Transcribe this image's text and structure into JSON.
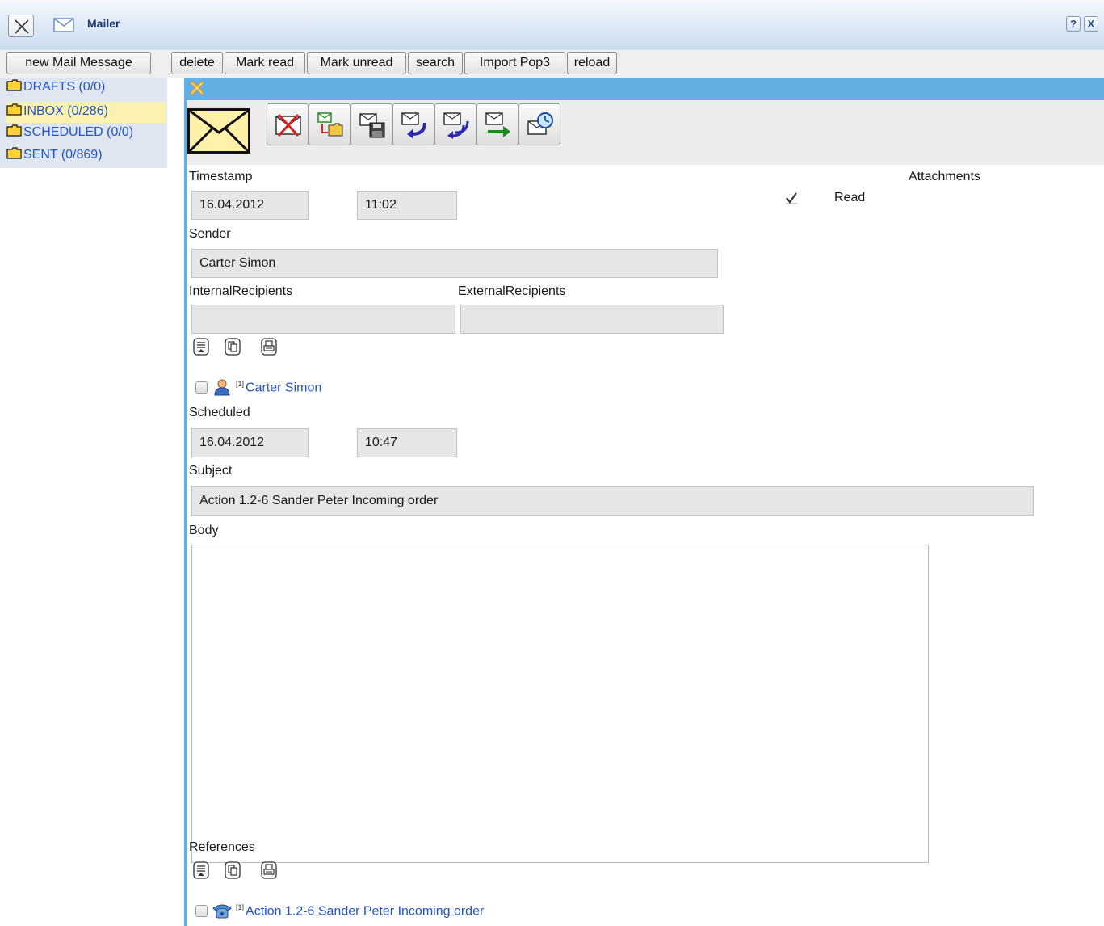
{
  "window": {
    "title": "Mailer",
    "help_label": "?",
    "close_label": "X"
  },
  "toolbar": {
    "new_mail_label": "new Mail Message",
    "delete_label": "delete",
    "mark_read_label": "Mark read",
    "mark_unread_label": "Mark unread",
    "search_label": "search",
    "import_label": "Import Pop3",
    "reload_label": "reload"
  },
  "sidebar": {
    "folders": [
      {
        "label": "DRAFTS (0/0)"
      },
      {
        "label": "INBOX (0/286)"
      },
      {
        "label": "SCHEDULED (0/0)"
      },
      {
        "label": "SENT (0/869)"
      }
    ],
    "selected_index": 1
  },
  "message": {
    "timestamp_label": "Timestamp",
    "timestamp_date": "16.04.2012",
    "timestamp_time": "11:02",
    "attachments_label": "Attachments",
    "read_label": "Read",
    "read_checked": true,
    "sender_label": "Sender",
    "sender_value": "Carter Simon",
    "internal_recipients_label": "InternalRecipients",
    "internal_recipients_value": "",
    "external_recipients_label": "ExternalRecipients",
    "external_recipients_value": "",
    "recipient_index": "[1]",
    "recipient_name": "Carter Simon",
    "scheduled_label": "Scheduled",
    "scheduled_date": "16.04.2012",
    "scheduled_time": "10:47",
    "subject_label": "Subject",
    "subject_value": "Action 1.2-6 Sander Peter Incoming order",
    "body_label": "Body",
    "body_value": "",
    "references_label": "References",
    "reference_index": "[1]",
    "reference_name": "Action 1.2-6 Sander Peter Incoming order"
  },
  "colors": {
    "panel_accent": "#63aee3",
    "link": "#2355c8",
    "selected_folder": "#fbf2b0"
  }
}
